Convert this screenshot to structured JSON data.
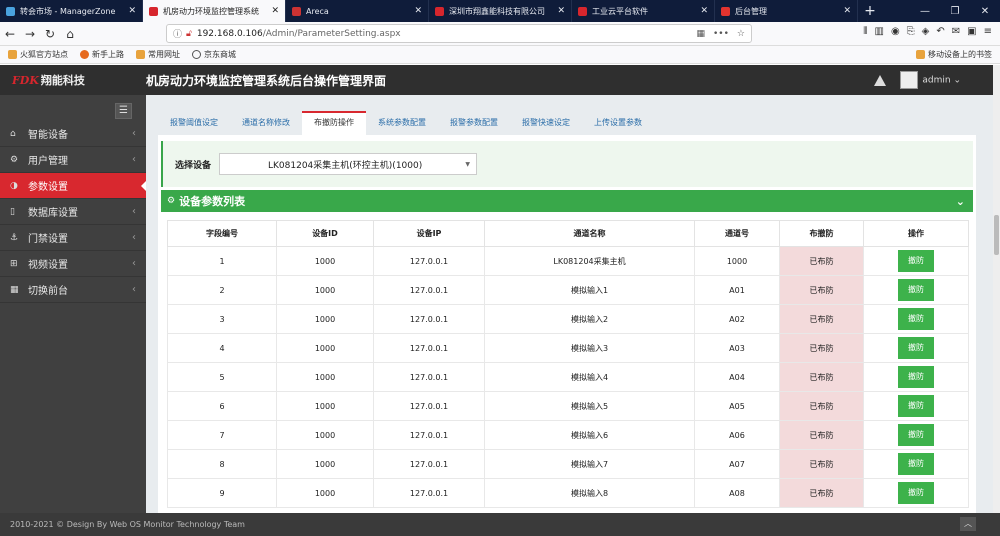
{
  "browser": {
    "tabs": [
      {
        "label": "转会市场 - ManagerZone",
        "favicon_color": "#4aa3df",
        "active": false
      },
      {
        "label": "机房动力环境监控管理系统",
        "favicon_color": "#d7262d",
        "active": true
      },
      {
        "label": "Areca",
        "favicon_color": "#c33",
        "active": false
      },
      {
        "label": "深圳市翔鑫能科技有限公司",
        "favicon_color": "#d7262d",
        "active": false
      },
      {
        "label": "工业云平台软件",
        "favicon_color": "#d7262d",
        "active": false
      },
      {
        "label": "后台管理",
        "favicon_color": "#e3342f",
        "active": false
      }
    ],
    "url_host": "192.168.0.106",
    "url_path": "/Admin/ParameterSetting.aspx",
    "bookmarks": [
      "火狐官方站点",
      "新手上路",
      "常用网址",
      "京东商城"
    ],
    "mobile_bookmarks": "移动设备上的书签"
  },
  "header": {
    "logo_mark": "FDK",
    "logo_text": "翔能科技",
    "title": "机房动力环境监控管理系统后台操作管理界面",
    "user": "admin"
  },
  "sidebar": {
    "items": [
      {
        "label": "智能设备",
        "icon": "dashboard-icon",
        "glyph": "⌂"
      },
      {
        "label": "用户管理",
        "icon": "users-icon",
        "glyph": "⚙"
      },
      {
        "label": "参数设置",
        "icon": "adjust-icon",
        "glyph": "◑"
      },
      {
        "label": "数据库设置",
        "icon": "bookmark-icon",
        "glyph": "▯"
      },
      {
        "label": "门禁设置",
        "icon": "anchor-icon",
        "glyph": "⚓"
      },
      {
        "label": "视频设置",
        "icon": "sitemap-icon",
        "glyph": "⊞"
      },
      {
        "label": "切换前台",
        "icon": "grid-icon",
        "glyph": "▦"
      }
    ]
  },
  "tabs": [
    "报警阈值设定",
    "通道名称修改",
    "布撤防操作",
    "系统参数配置",
    "报警参数配置",
    "报警快速设定",
    "上传设置参数"
  ],
  "device_select": {
    "label": "选择设备",
    "value": "LK081204采集主机(环控主机)(1000)"
  },
  "list_title": "设备参数列表",
  "table": {
    "headers": [
      "字段编号",
      "设备ID",
      "设备IP",
      "通道名称",
      "通道号",
      "布撤防",
      "操作"
    ],
    "rows": [
      [
        "1",
        "1000",
        "127.0.0.1",
        "LK081204采集主机",
        "1000",
        "已布防",
        "撤防"
      ],
      [
        "2",
        "1000",
        "127.0.0.1",
        "模拟输入1",
        "A01",
        "已布防",
        "撤防"
      ],
      [
        "3",
        "1000",
        "127.0.0.1",
        "模拟输入2",
        "A02",
        "已布防",
        "撤防"
      ],
      [
        "4",
        "1000",
        "127.0.0.1",
        "模拟输入3",
        "A03",
        "已布防",
        "撤防"
      ],
      [
        "5",
        "1000",
        "127.0.0.1",
        "模拟输入4",
        "A04",
        "已布防",
        "撤防"
      ],
      [
        "6",
        "1000",
        "127.0.0.1",
        "模拟输入5",
        "A05",
        "已布防",
        "撤防"
      ],
      [
        "7",
        "1000",
        "127.0.0.1",
        "模拟输入6",
        "A06",
        "已布防",
        "撤防"
      ],
      [
        "8",
        "1000",
        "127.0.0.1",
        "模拟输入7",
        "A07",
        "已布防",
        "撤防"
      ],
      [
        "9",
        "1000",
        "127.0.0.1",
        "模拟输入8",
        "A08",
        "已布防",
        "撤防"
      ]
    ]
  },
  "footer": "2010-2021 © Design By Web OS Monitor Technology Team",
  "colors": {
    "accent_red": "#d8282f",
    "green": "#39a84a",
    "pink": "#f3dadb"
  }
}
